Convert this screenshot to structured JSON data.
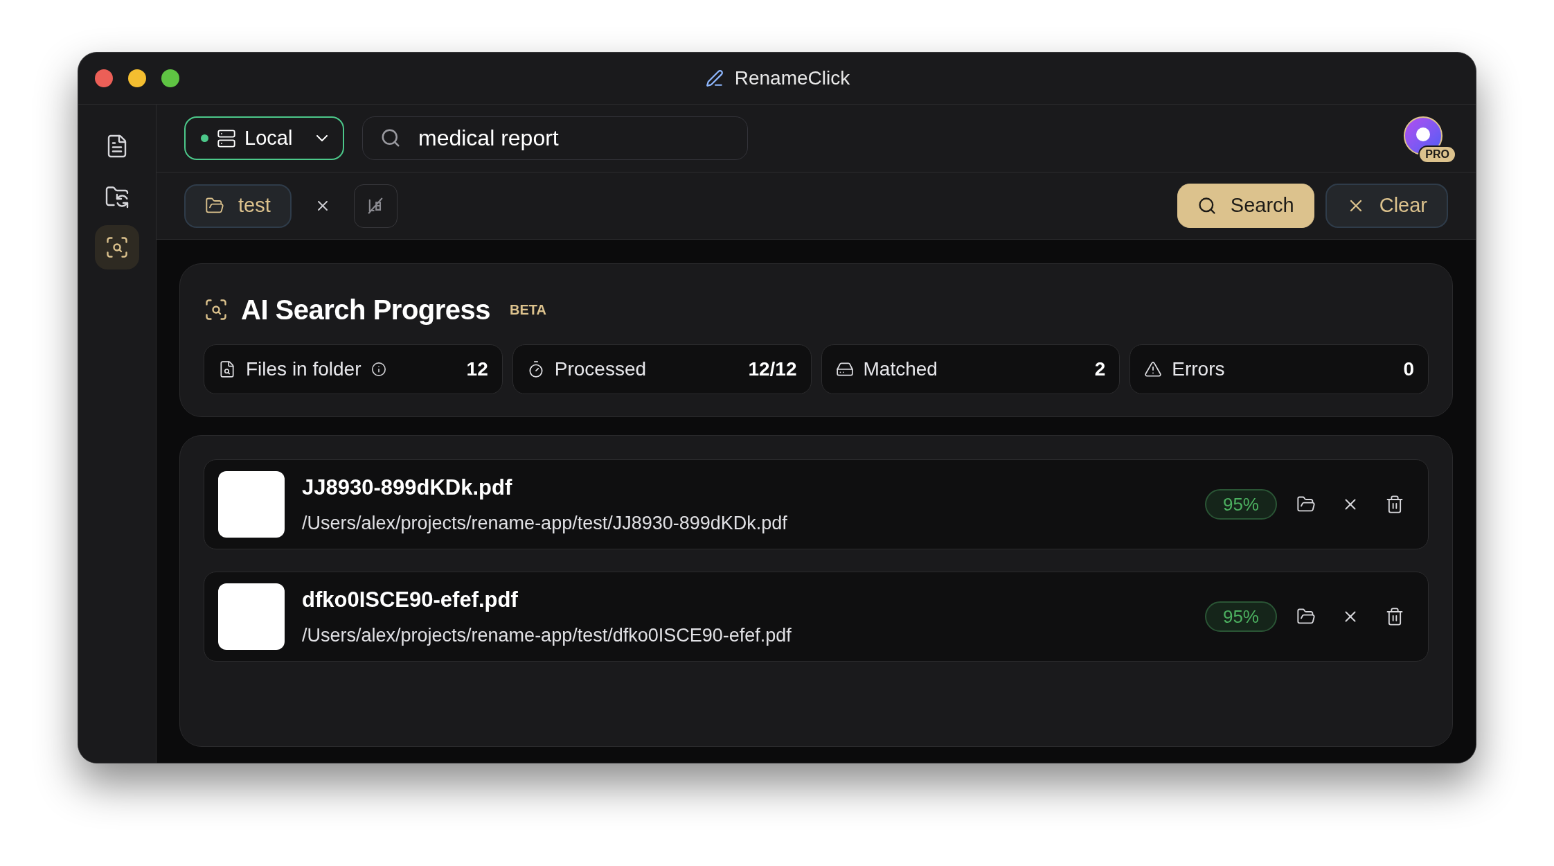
{
  "window": {
    "title": "RenameClick"
  },
  "sidebar": {
    "items": [
      {
        "selected": false
      },
      {
        "selected": false
      },
      {
        "selected": true
      }
    ]
  },
  "toolbar": {
    "source": {
      "label": "Local"
    },
    "query": {
      "value": "medical report"
    },
    "account": {
      "badge": "PRO"
    },
    "folder_chip": {
      "label": "test"
    },
    "buttons": [
      {
        "kind": "primary",
        "label": "Search"
      },
      {
        "kind": "secondary",
        "label": "Clear"
      }
    ]
  },
  "progress": {
    "title": "AI Search Progress",
    "badge": "BETA",
    "stats": [
      {
        "label": "Files in folder",
        "value": "12",
        "info": true
      },
      {
        "label": "Processed",
        "value": "12/12",
        "info": false
      },
      {
        "label": "Matched",
        "value": "2",
        "info": false
      },
      {
        "label": "Errors",
        "value": "0",
        "info": false
      }
    ]
  },
  "results": [
    {
      "name": "JJ8930-899dKDk.pdf",
      "path": "/Users/alex/projects/rename-app/test/JJ8930-899dKDk.pdf",
      "score": "95%"
    },
    {
      "name": "dfko0ISCE90-efef.pdf",
      "path": "/Users/alex/projects/rename-app/test/dfko0ISCE90-efef.pdf",
      "score": "95%"
    }
  ]
}
